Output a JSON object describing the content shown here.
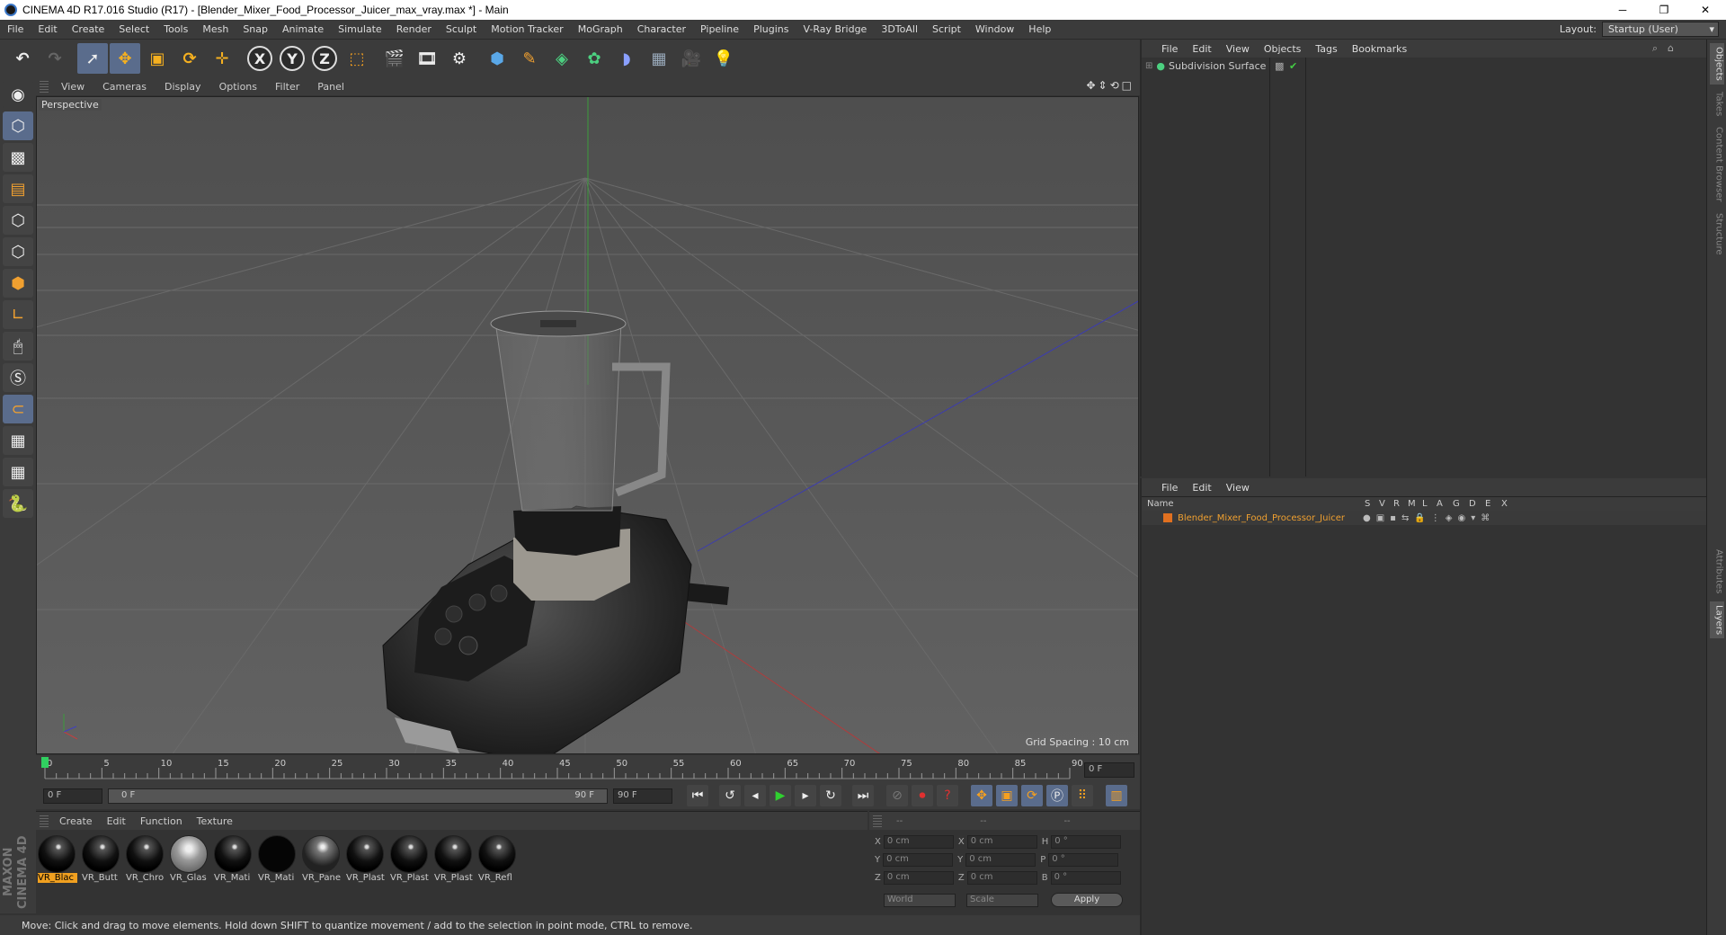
{
  "window": {
    "title": "CINEMA 4D R17.016 Studio (R17) - [Blender_Mixer_Food_Processor_Juicer_max_vray.max *] - Main",
    "controls": [
      "─",
      "❐",
      "✕"
    ]
  },
  "menubar": {
    "items": [
      "File",
      "Edit",
      "Create",
      "Select",
      "Tools",
      "Mesh",
      "Snap",
      "Animate",
      "Simulate",
      "Render",
      "Sculpt",
      "Motion Tracker",
      "MoGraph",
      "Character",
      "Pipeline",
      "Plugins",
      "V-Ray Bridge",
      "3DToAll",
      "Script",
      "Window",
      "Help"
    ],
    "layout_label": "Layout:",
    "layout_value": "Startup (User)"
  },
  "toolbar": {
    "axis_x": "X",
    "axis_y": "Y",
    "axis_z": "Z"
  },
  "viewport": {
    "menu": [
      "View",
      "Cameras",
      "Display",
      "Options",
      "Filter",
      "Panel"
    ],
    "nav_icons": "✥⇕⟲□",
    "label": "Perspective",
    "grid_spacing": "Grid Spacing : 10 cm"
  },
  "timeline": {
    "ticks": [
      "0",
      "5",
      "10",
      "15",
      "20",
      "25",
      "30",
      "35",
      "40",
      "45",
      "50",
      "55",
      "60",
      "65",
      "70",
      "75",
      "80",
      "85",
      "90"
    ],
    "end_field": "0 F",
    "start_frame": "0 F",
    "range_start": "0 F",
    "range_end": "90 F",
    "max_frame": "90 F"
  },
  "materials": {
    "menu": [
      "Create",
      "Edit",
      "Function",
      "Texture"
    ],
    "items": [
      {
        "name": "VR_Blac",
        "kind": "dark"
      },
      {
        "name": "VR_Butt",
        "kind": "dark"
      },
      {
        "name": "VR_Chro",
        "kind": "dark"
      },
      {
        "name": "VR_Glas",
        "kind": "glass"
      },
      {
        "name": "VR_Mati",
        "kind": "dark"
      },
      {
        "name": "VR_Mati",
        "kind": "black"
      },
      {
        "name": "VR_Pane",
        "kind": "pane"
      },
      {
        "name": "VR_Plast",
        "kind": "dark"
      },
      {
        "name": "VR_Plast",
        "kind": "dark"
      },
      {
        "name": "VR_Plast",
        "kind": "dark"
      },
      {
        "name": "VR_Refl",
        "kind": "dark"
      }
    ]
  },
  "coords": {
    "headers": [
      "--",
      "--",
      "--"
    ],
    "rows": [
      {
        "a": "X",
        "av": "0 cm",
        "b": "X",
        "bv": "0 cm",
        "c": "H",
        "cv": "0 °"
      },
      {
        "a": "Y",
        "av": "0 cm",
        "b": "Y",
        "bv": "0 cm",
        "c": "P",
        "cv": "0 °"
      },
      {
        "a": "Z",
        "av": "0 cm",
        "b": "Z",
        "bv": "0 cm",
        "c": "B",
        "cv": "0 °"
      }
    ],
    "space": "World",
    "mode": "Scale",
    "apply": "Apply"
  },
  "status": "Move: Click and drag to move elements. Hold down SHIFT to quantize movement / add to the selection in point mode, CTRL to remove.",
  "object_manager": {
    "menu": [
      "File",
      "Edit",
      "View",
      "Objects",
      "Tags",
      "Bookmarks"
    ],
    "objects": [
      {
        "name": "Subdivision Surface"
      }
    ]
  },
  "layer_manager": {
    "menu": [
      "File",
      "Edit",
      "View"
    ],
    "columns": [
      "Name",
      "S",
      "V",
      "R",
      "M",
      "L",
      "A",
      "G",
      "D",
      "E",
      "X"
    ],
    "layers": [
      {
        "name": "Blender_Mixer_Food_Processor_Juicer",
        "color": "#e07020"
      }
    ]
  },
  "right_tabs": [
    "Objects",
    "Takes",
    "Content Browser",
    "Structure",
    "Attributes",
    "Layers"
  ],
  "maxon_logo": "MAXON CINEMA 4D"
}
